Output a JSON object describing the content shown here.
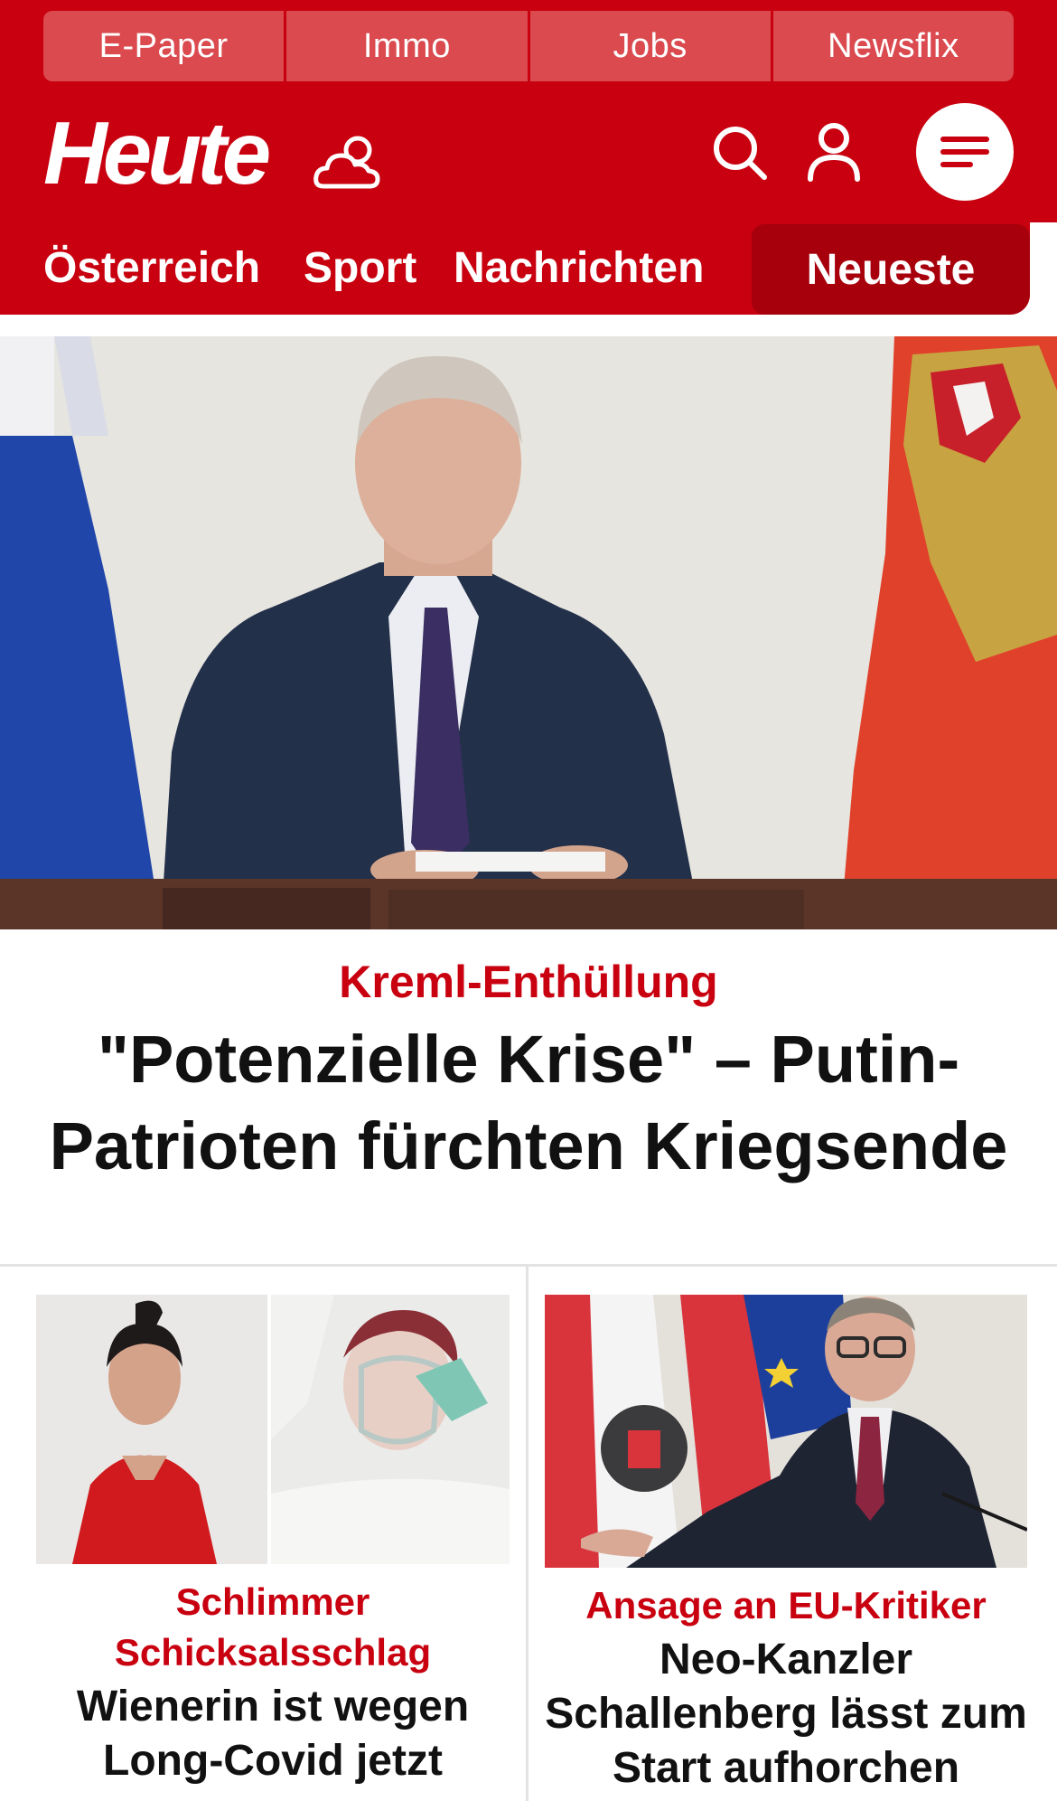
{
  "service_links": [
    "E-Paper",
    "Immo",
    "Jobs",
    "Newsflix"
  ],
  "header": {
    "logo_text": "Heute",
    "brand_color": "#c8000f",
    "icons": [
      "weather-cloud-icon",
      "search-icon",
      "user-icon",
      "menu-icon"
    ]
  },
  "nav": {
    "items": [
      "Österreich",
      "Sport",
      "Nachrichten"
    ],
    "active": "Neueste"
  },
  "hero": {
    "kicker": "Kreml-Enthüllung",
    "title": "\"Potenzielle Krise\" – Putin-Patrioten fürchten Kriegsende"
  },
  "teasers": [
    {
      "kicker": "Schlimmer Schicksalsschlag",
      "title": "Wienerin ist wegen Long-Covid jetzt"
    },
    {
      "kicker": "Ansage an EU-Kritiker",
      "title": "Neo-Kanzler Schallenberg lässt zum Start aufhorchen"
    }
  ]
}
